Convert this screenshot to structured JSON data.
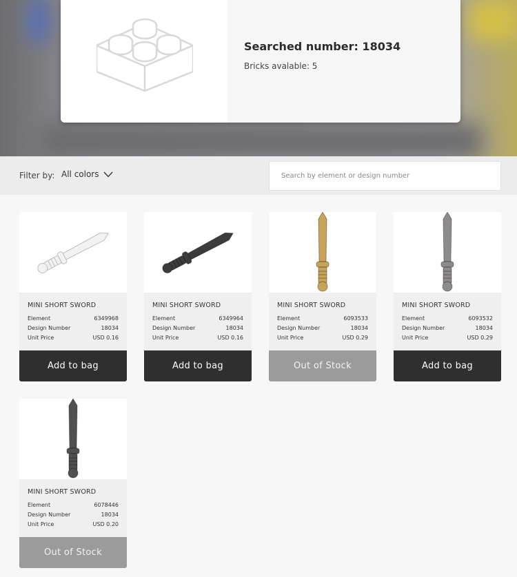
{
  "result": {
    "title": "Searched number: 18034",
    "subtitle": "Bricks avalable: 5",
    "icon": "brick-icon"
  },
  "filter": {
    "label": "Filter by:",
    "selected": "All colors",
    "search_placeholder": "Search by element or design number"
  },
  "labels": {
    "element": "Element",
    "design": "Design Number",
    "price": "Unit Price"
  },
  "products": [
    {
      "name": "MINI SHORT SWORD",
      "element": "6349968",
      "design": "18034",
      "price": "USD 0.16",
      "button": "Add to bag",
      "available": true,
      "color": "#f2f2f2"
    },
    {
      "name": "MINI SHORT SWORD",
      "element": "6349964",
      "design": "18034",
      "price": "USD 0.16",
      "button": "Add to bag",
      "available": true,
      "color": "#3c3c3e"
    },
    {
      "name": "MINI SHORT SWORD",
      "element": "6093533",
      "design": "18034",
      "price": "USD 0.29",
      "button": "Out of Stock",
      "available": false,
      "color": "#c8a458"
    },
    {
      "name": "MINI SHORT SWORD",
      "element": "6093532",
      "design": "18034",
      "price": "USD 0.29",
      "button": "Add to bag",
      "available": true,
      "color": "#8e8c8a"
    },
    {
      "name": "MINI SHORT SWORD",
      "element": "6078446",
      "design": "18034",
      "price": "USD 0.20",
      "button": "Out of Stock",
      "available": false,
      "color": "#505052"
    }
  ]
}
